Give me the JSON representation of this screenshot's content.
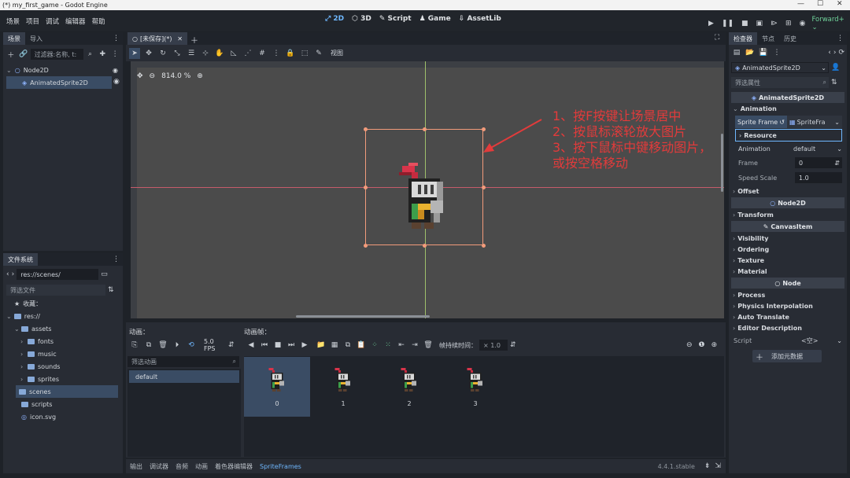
{
  "window": {
    "title": "(*) my_first_game - Godot Engine",
    "controls": [
      "—",
      "☐",
      "✕"
    ]
  },
  "menu": {
    "items": [
      "场景",
      "项目",
      "调试",
      "编辑器",
      "帮助"
    ],
    "workspaces": [
      "2D",
      "3D",
      "Script",
      "Game",
      "AssetLib"
    ],
    "renderer": "Forward+"
  },
  "scene_dock": {
    "tabs": [
      "场景",
      "导入"
    ],
    "filter_placeholder": "过滤器:名称, t:",
    "nodes": [
      {
        "name": "Node2D",
        "icon": "node2d-icon"
      },
      {
        "name": "AnimatedSprite2D",
        "icon": "animated-sprite-icon"
      }
    ]
  },
  "filesystem": {
    "tab": "文件系统",
    "path": "res://scenes/",
    "filter_placeholder": "筛选文件",
    "favorites": "收藏：",
    "root": "res://",
    "items": [
      {
        "name": "assets",
        "level": 1
      },
      {
        "name": "fonts",
        "level": 2
      },
      {
        "name": "music",
        "level": 2
      },
      {
        "name": "sounds",
        "level": 2
      },
      {
        "name": "sprites",
        "level": 2
      },
      {
        "name": "scenes",
        "level": 1
      },
      {
        "name": "scripts",
        "level": 1
      },
      {
        "name": "icon.svg",
        "level": 1
      }
    ]
  },
  "editor": {
    "scene_tab": "[未保存](*)",
    "toolbar_view": "视图",
    "zoom": "814.0 %"
  },
  "annotations": [
    "1、按F按键让场景居中",
    "2、按鼠标滚轮放大图片",
    "3、按下鼠标中键移动图片，或按空格移动"
  ],
  "animation_panel": {
    "animations_label": "动画：",
    "frames_label": "动画帧：",
    "fps": "5.0 FPS",
    "filter_placeholder": "筛选动画",
    "animations": [
      "default"
    ],
    "frame_duration_label": "帧持续时间：",
    "frame_duration": "× 1.0",
    "frames": [
      "0",
      "1",
      "2",
      "3"
    ]
  },
  "bottom_bar": {
    "tabs": [
      "输出",
      "调试器",
      "音频",
      "动画",
      "着色器编辑器",
      "SpriteFrames"
    ],
    "version": "4.4.1.stable"
  },
  "inspector": {
    "tabs": [
      "检查器",
      "节点",
      "历史"
    ],
    "object": "AnimatedSprite2D",
    "filter_placeholder": "筛选属性",
    "class_header": "AnimatedSprite2D",
    "animation_section": "Animation",
    "sprite_frames_label": "Sprite Frame",
    "sprite_frames_value": "SpriteFra",
    "resource_label": "Resource",
    "animation_label": "Animation",
    "animation_value": "default",
    "frame_label": "Frame",
    "frame_value": "0",
    "speed_scale_label": "Speed Scale",
    "speed_scale_value": "1.0",
    "offset": "Offset",
    "node2d_header": "Node2D",
    "transform": "Transform",
    "canvasitem_header": "CanvasItem",
    "canvas_items": [
      "Visibility",
      "Ordering",
      "Texture",
      "Material"
    ],
    "node_header": "Node",
    "node_items": [
      "Process",
      "Physics Interpolation",
      "Auto Translate",
      "Editor Description"
    ],
    "script_label": "Script",
    "script_value": "<空>",
    "add_metadata": "添加元数据"
  },
  "colors": {
    "accent": "#6fb8ff",
    "annotation": "#e23b3b",
    "viewport_bg": "#4b4b4b",
    "selection_rect": "#f29b7b"
  }
}
